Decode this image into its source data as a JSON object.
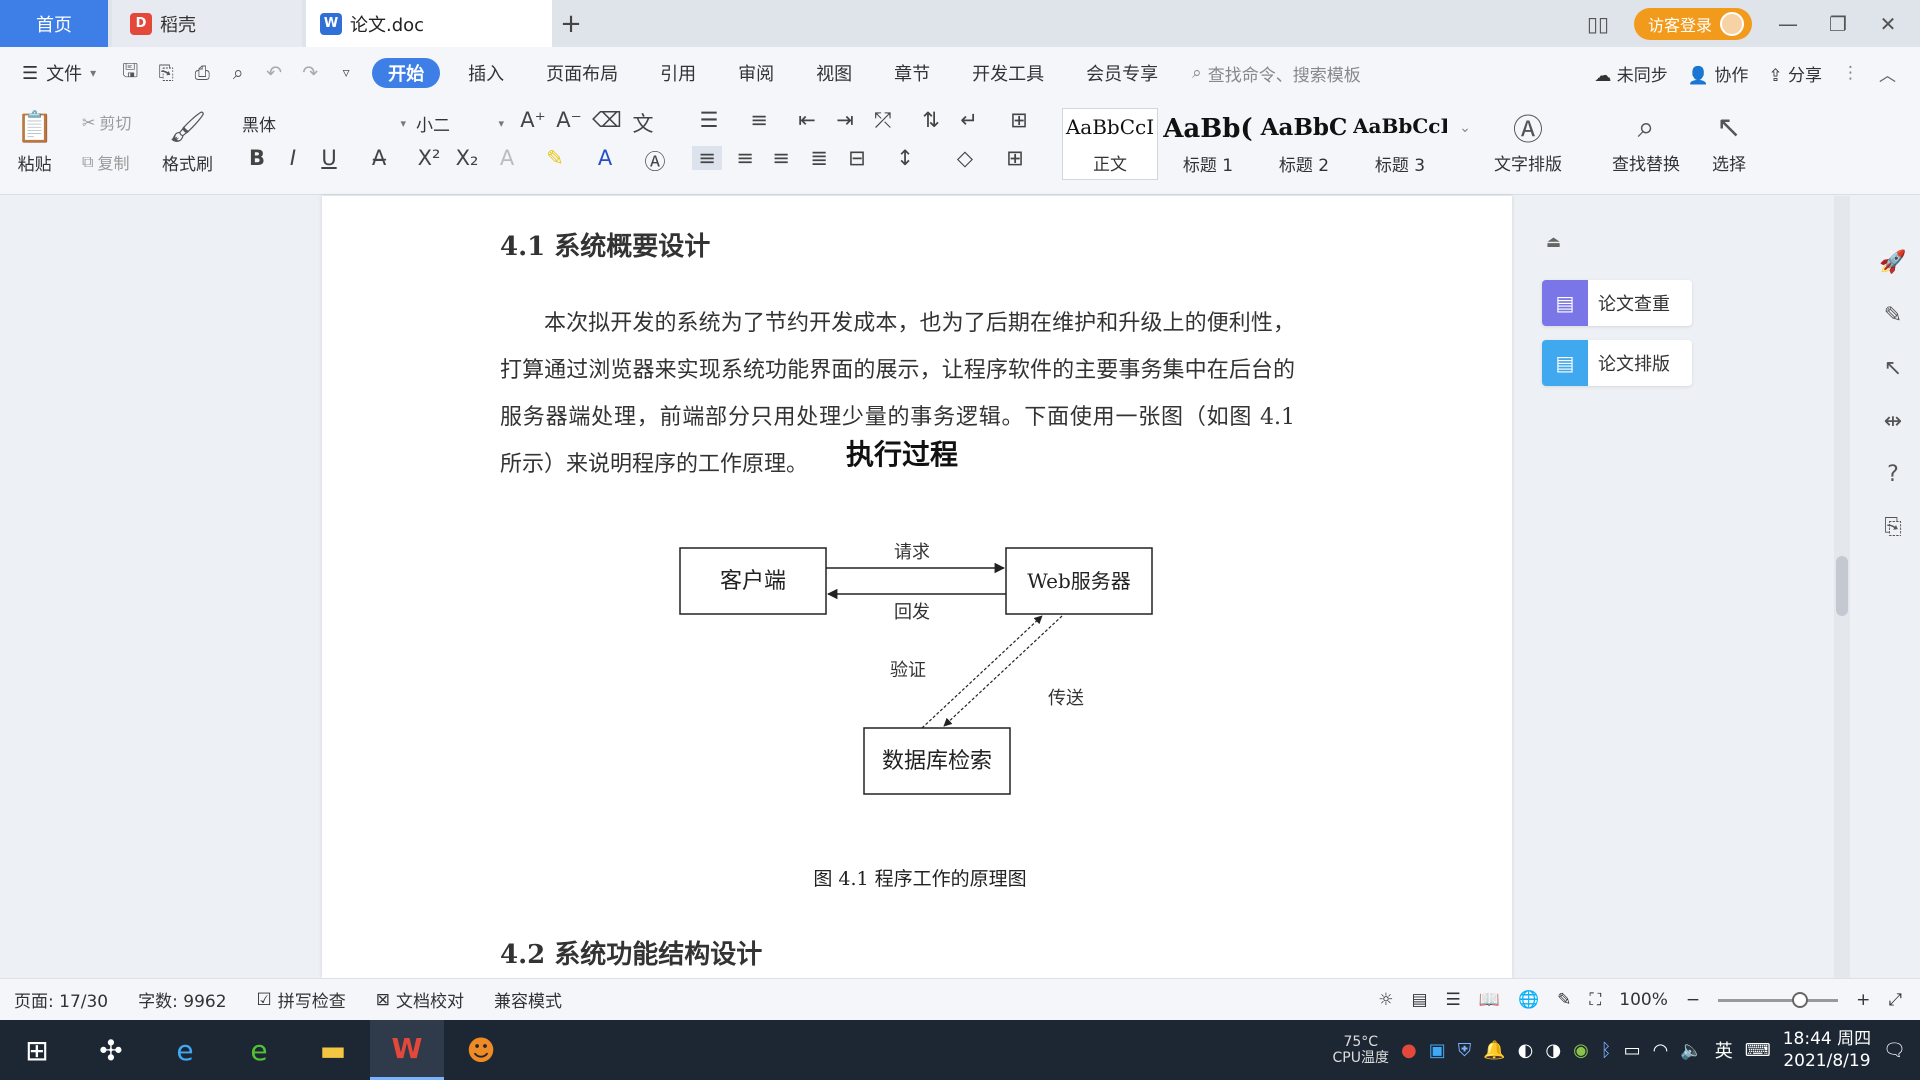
{
  "tabs": {
    "home": "首页",
    "daoke": "稻壳",
    "doc": "论文.doc",
    "add": "+",
    "visitor": "访客登录"
  },
  "menu": {
    "file": "文件",
    "items": [
      "开始",
      "插入",
      "页面布局",
      "引用",
      "审阅",
      "视图",
      "章节",
      "开发工具",
      "会员专享"
    ],
    "search_placeholder": "查找命令、搜索模板",
    "unsynced": "未同步",
    "collab": "协作",
    "share": "分享"
  },
  "ribbon": {
    "paste": "粘贴",
    "cut": "剪切",
    "copy": "复制",
    "format_painter": "格式刷",
    "font_name": "黑体",
    "font_size": "小二",
    "styles": [
      {
        "sample": "AaBbCcI",
        "label": "正文"
      },
      {
        "sample": "AaBb(",
        "label": "标题 1"
      },
      {
        "sample": "AaBbC",
        "label": "标题 2"
      },
      {
        "sample": "AaBbCcI",
        "label": "标题 3"
      }
    ],
    "text_layout": "文字排版",
    "find_replace": "查找替换",
    "select": "选择"
  },
  "document": {
    "heading1": "4.1  系统概要设计",
    "paragraph": "本次拟开发的系统为了节约开发成本，也为了后期在维护和升级上的便利性，打算通过浏览器来实现系统功能界面的展示，让程序软件的主要事务集中在后台的服务器端处理，前端部分只用处理少量的事务逻辑。下面使用一张图（如图 4.1 所示）来说明程序的工作原理。",
    "diagram": {
      "title": "执行过程",
      "client": "客户端",
      "server": "Web服务器",
      "db": "数据库检索",
      "request": "请求",
      "reply": "回发",
      "verify": "验证",
      "transfer": "传送"
    },
    "caption": "图 4.1  程序工作的原理图",
    "heading2": "4.2  系统功能结构设计"
  },
  "sidepanel": {
    "check": "论文查重",
    "layout": "论文排版"
  },
  "status": {
    "page": "页面: 17/30",
    "words": "字数: 9962",
    "spell": "拼写检查",
    "proof": "文档校对",
    "compat": "兼容模式",
    "zoom": "100%",
    "zoom_fraction": 0.68
  },
  "taskbar": {
    "cpu_temp": "75°C",
    "cpu_label": "CPU温度",
    "ime": "英",
    "time": "18:44 周四",
    "date": "2021/8/19"
  },
  "colors": {
    "accent": "#3d7fe6",
    "visitor": "#f29a1b",
    "check_icon": "#7b76e8",
    "layout_icon": "#3fa8ef"
  }
}
